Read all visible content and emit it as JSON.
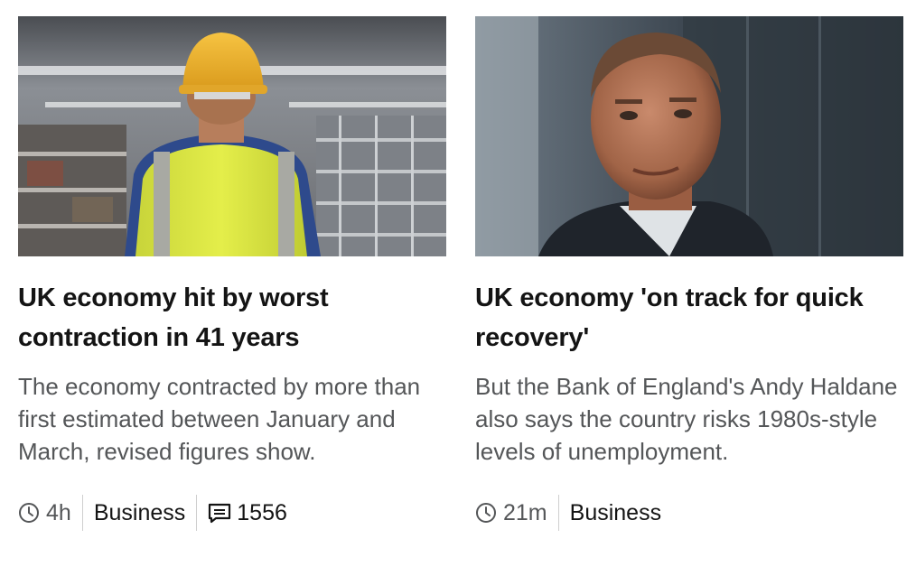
{
  "stories": [
    {
      "image": "worker-in-hi-vis-vest-and-hard-hat-warehouse",
      "headline": "UK economy hit by worst contraction in 41 years",
      "summary": "The economy contracted by more than first estimated between January and March, revised figures show.",
      "time": "4h",
      "section": "Business",
      "comments": "1556",
      "icons": {
        "time": "clock-icon",
        "comments": "comment-icon"
      }
    },
    {
      "image": "portrait-of-andy-haldane",
      "headline": "UK economy 'on track for quick recovery'",
      "summary": "But the Bank of England's Andy Haldane also says the country risks 1980s-style levels of unemployment.",
      "time": "21m",
      "section": "Business",
      "icons": {
        "time": "clock-icon"
      }
    }
  ],
  "colors": {
    "headline": "#141414",
    "summary": "#545658",
    "divider": "#cfcfcf"
  }
}
